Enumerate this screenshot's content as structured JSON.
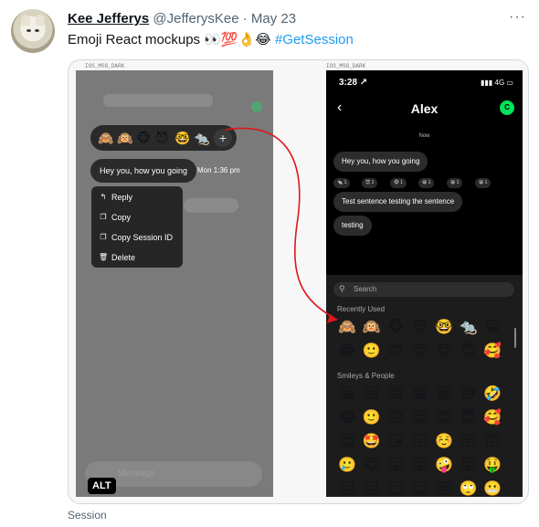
{
  "tweet": {
    "author_name": "Kee Jefferys",
    "handle": "@JefferysKee",
    "separator": "·",
    "date": "May 23",
    "more": "···",
    "text_prefix": "Emoji React mockups 👀💯👌😂 ",
    "hashtag": "#GetSession",
    "footer": "Session"
  },
  "media": {
    "alt_badge": "ALT",
    "left_phone": {
      "label": "IOS_MSG_DARK",
      "reaction_emojis": [
        "🙈",
        "🙉",
        "🐵",
        "😈",
        "🤓",
        "🐀"
      ],
      "plus": "+",
      "message": "Hey you, how you going",
      "timestamp": "Mon 1:36 pm",
      "context_menu": [
        {
          "icon": "reply-icon",
          "glyph": "↰",
          "label": "Reply"
        },
        {
          "icon": "copy-icon",
          "glyph": "❐",
          "label": "Copy"
        },
        {
          "icon": "copy-session-id-icon",
          "glyph": "❐",
          "label": "Copy Session ID"
        },
        {
          "icon": "trash-icon",
          "glyph": "🗑",
          "label": "Delete"
        }
      ],
      "composer_placeholder": "Message"
    },
    "right_phone": {
      "label": "IOS_MSG_DARK",
      "time": "3:28 ↗",
      "signal": "▮▮▮ 4G ▭",
      "back": "‹",
      "contact": "Alex",
      "avatar_letter": "C",
      "accent_color": "#00e35a",
      "now": "Now",
      "message1": "Hey you, how you going",
      "reactions": [
        "🐀 1",
        "😈 1",
        "🐵 1",
        "😀 1",
        "😀 1",
        "😀 1"
      ],
      "message2": "Test sentence testing the sentence",
      "message3": "testing",
      "search_placeholder": "Search",
      "section_recent": "Recently Used",
      "recent": [
        "🙈",
        "🙉",
        "🐵",
        "😈",
        "🤓",
        "🐀",
        "😀",
        "😂",
        "🙂",
        "🙃",
        "😉",
        "😊",
        "😇",
        "🥰"
      ],
      "section_smileys": "Smileys & People",
      "smileys": [
        "😀",
        "😃",
        "😄",
        "😁",
        "😆",
        "😅",
        "🤣",
        "😂",
        "🙂",
        "🙃",
        "😉",
        "😊",
        "😇",
        "🥰",
        "😍",
        "🤩",
        "😘",
        "😗",
        "☺️",
        "😚",
        "😙",
        "🥲",
        "😋",
        "😛",
        "😜",
        "🤪",
        "😝",
        "🤑",
        "😐",
        "😑",
        "😶",
        "😏",
        "😒",
        "🙄",
        "😬"
      ]
    }
  }
}
